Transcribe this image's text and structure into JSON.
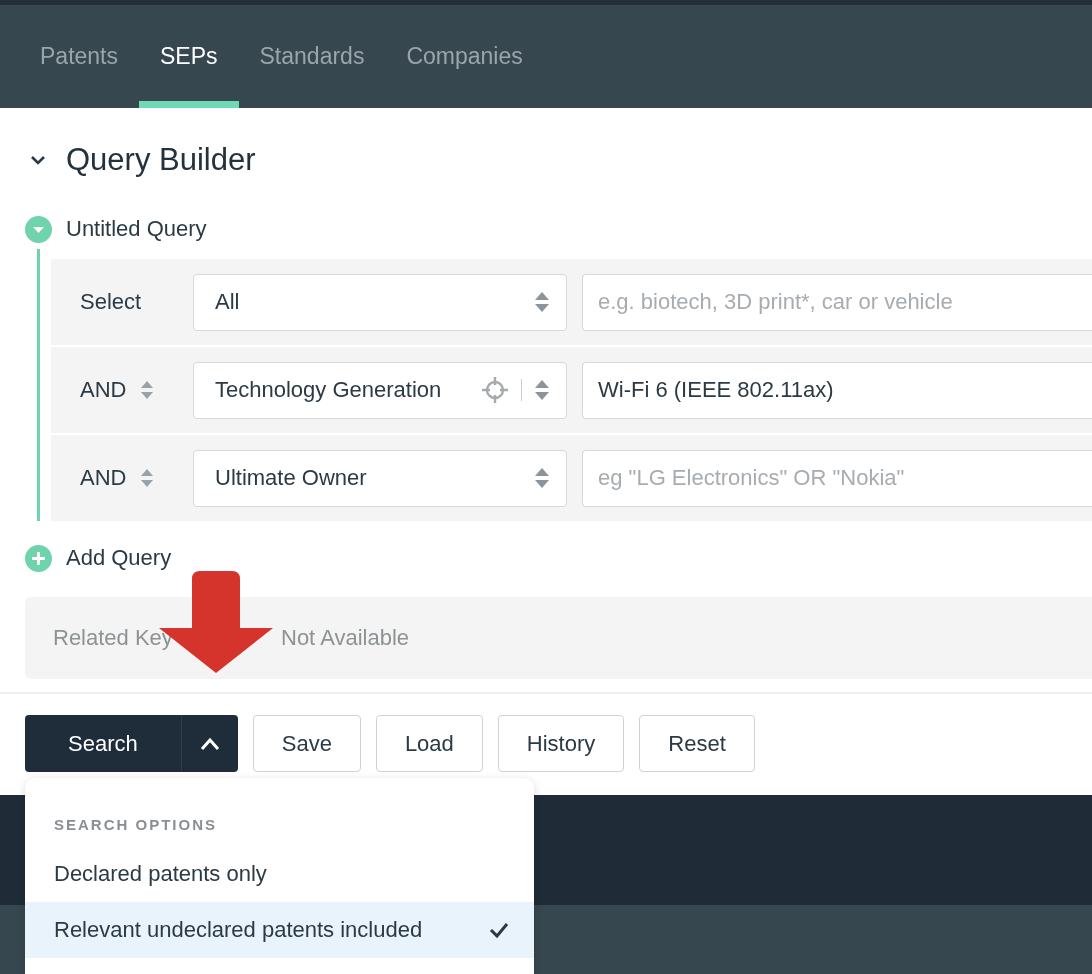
{
  "tabs": [
    {
      "label": "Patents",
      "selected": false
    },
    {
      "label": "SEPs",
      "selected": true
    },
    {
      "label": "Standards",
      "selected": false
    },
    {
      "label": "Companies",
      "selected": false
    }
  ],
  "query_builder": {
    "title": "Query Builder",
    "expanded": true,
    "query": {
      "name": "Untitled Query",
      "expanded": true,
      "rows": [
        {
          "operator": "Select",
          "kind": "fixed",
          "field": "All",
          "target_icon": false,
          "input": {
            "placeholder": "e.g. biotech, 3D print*, car or vehicle"
          }
        },
        {
          "operator": "AND",
          "kind": "sortable",
          "field": "Technology Generation",
          "target_icon": true,
          "input": {
            "value": "Wi-Fi 6 (IEEE 802.11ax)"
          }
        },
        {
          "operator": "AND",
          "kind": "sortable",
          "field": "Ultimate Owner",
          "target_icon": false,
          "input": {
            "placeholder": "eg \"LG Electronics\" OR \"Nokia\""
          }
        }
      ]
    },
    "add_query": "Add Query",
    "related": {
      "label": "Related Key",
      "value": "Not Available"
    }
  },
  "actions": {
    "search": "Search",
    "menu_open": true,
    "buttons": [
      "Save",
      "Load",
      "History",
      "Reset"
    ]
  },
  "search_options": {
    "heading": "SEARCH OPTIONS",
    "items": [
      {
        "label": "Declared patents only",
        "selected": false
      },
      {
        "label": "Relevant undeclared patents included",
        "selected": true
      }
    ]
  }
}
